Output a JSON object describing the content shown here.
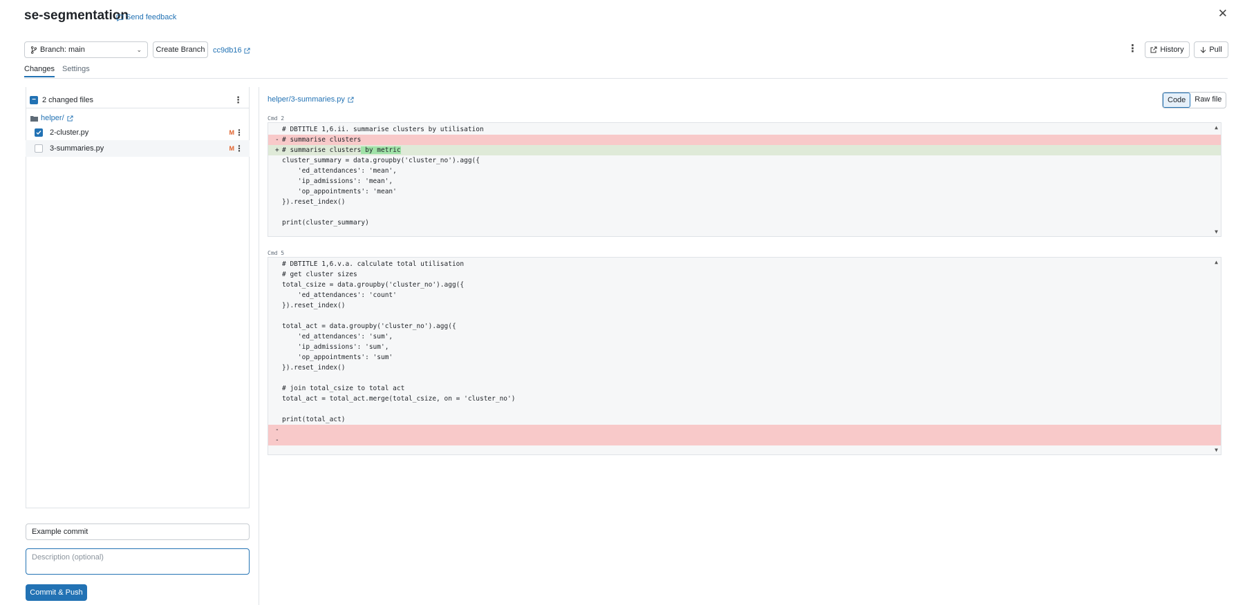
{
  "header": {
    "title": "se-segmentation",
    "feedback_label": "Send feedback"
  },
  "toolbar": {
    "branch_label": "Branch: main",
    "create_branch_label": "Create Branch",
    "commit_hash": "cc9db16",
    "history_label": "History",
    "pull_label": "Pull"
  },
  "tabs": [
    {
      "label": "Changes",
      "active": true
    },
    {
      "label": "Settings",
      "active": false
    }
  ],
  "changes": {
    "count_label": "2 changed files",
    "folder": "helper/",
    "files": [
      {
        "name": "2-cluster.py",
        "status": "M",
        "checked": true
      },
      {
        "name": "3-summaries.py",
        "status": "M",
        "checked": false
      }
    ]
  },
  "commit": {
    "message_value": "Example commit",
    "description_placeholder": "Description (optional)",
    "button_label": "Commit & Push"
  },
  "diff": {
    "file_path": "helper/3-summaries.py",
    "view_modes": [
      "Code",
      "Raw file"
    ],
    "active_view": "Code",
    "cells": [
      {
        "label": "Cmd 2",
        "lines": [
          {
            "type": "ctx",
            "text": "# DBTITLE 1,6.ii. summarise clusters by utilisation"
          },
          {
            "type": "del",
            "text": "# summarise clusters"
          },
          {
            "type": "add",
            "text": "# summarise clusters",
            "highlight": " by metric"
          },
          {
            "type": "ctx",
            "text": "cluster_summary = data.groupby('cluster_no').agg({"
          },
          {
            "type": "ctx",
            "text": "    'ed_attendances': 'mean',"
          },
          {
            "type": "ctx",
            "text": "    'ip_admissions': 'mean',"
          },
          {
            "type": "ctx",
            "text": "    'op_appointments': 'mean'"
          },
          {
            "type": "ctx",
            "text": "}).reset_index()"
          },
          {
            "type": "ctx",
            "text": ""
          },
          {
            "type": "ctx",
            "text": "print(cluster_summary)"
          },
          {
            "type": "ctx",
            "text": ""
          }
        ]
      },
      {
        "label": "Cmd 5",
        "lines": [
          {
            "type": "ctx",
            "text": "# DBTITLE 1,6.v.a. calculate total utilisation"
          },
          {
            "type": "ctx",
            "text": "# get cluster sizes"
          },
          {
            "type": "ctx",
            "text": "total_csize = data.groupby('cluster_no').agg({"
          },
          {
            "type": "ctx",
            "text": "    'ed_attendances': 'count'"
          },
          {
            "type": "ctx",
            "text": "}).reset_index()"
          },
          {
            "type": "ctx",
            "text": ""
          },
          {
            "type": "ctx",
            "text": "total_act = data.groupby('cluster_no').agg({"
          },
          {
            "type": "ctx",
            "text": "    'ed_attendances': 'sum',"
          },
          {
            "type": "ctx",
            "text": "    'ip_admissions': 'sum',"
          },
          {
            "type": "ctx",
            "text": "    'op_appointments': 'sum'"
          },
          {
            "type": "ctx",
            "text": "}).reset_index()"
          },
          {
            "type": "ctx",
            "text": ""
          },
          {
            "type": "ctx",
            "text": "# join total_csize to total act"
          },
          {
            "type": "ctx",
            "text": "total_act = total_act.merge(total_csize, on = 'cluster_no')"
          },
          {
            "type": "ctx",
            "text": ""
          },
          {
            "type": "ctx",
            "text": "print(total_act)"
          },
          {
            "type": "del",
            "text": ""
          },
          {
            "type": "del",
            "text": ""
          },
          {
            "type": "ctx",
            "text": ""
          }
        ]
      }
    ]
  },
  "colors": {
    "accent": "#2272b4",
    "deleted_line": "#f8c9c9",
    "added_line": "#dfead8",
    "added_highlight": "#9fe2a7",
    "modified_badge": "#e0612b"
  }
}
